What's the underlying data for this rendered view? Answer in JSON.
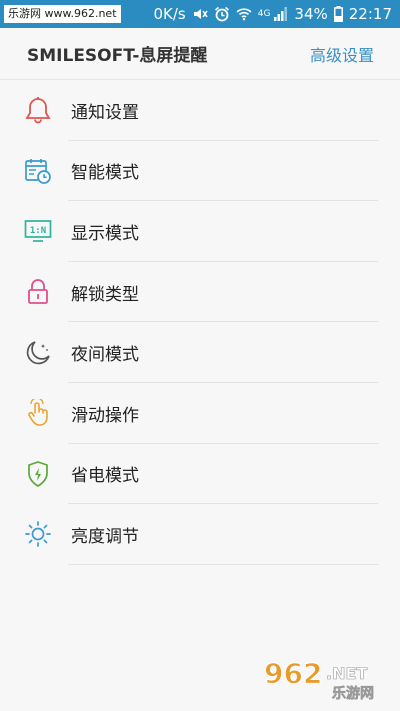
{
  "status_bar": {
    "watermark": "乐游网 www.962.net",
    "net_speed": "0K/s",
    "network_type": "4G",
    "battery": "34%",
    "time": "22:17"
  },
  "header": {
    "title": "SMILESOFT-息屏提醒",
    "advanced_settings": "高级设置"
  },
  "menu": [
    {
      "label": "通知设置",
      "icon": "bell-icon",
      "color": "#e0564e"
    },
    {
      "label": "智能模式",
      "icon": "calendar-clock-icon",
      "color": "#3a9bd0"
    },
    {
      "label": "显示模式",
      "icon": "display-icon",
      "color": "#2fb39a"
    },
    {
      "label": "解锁类型",
      "icon": "lock-icon",
      "color": "#e0508a"
    },
    {
      "label": "夜间模式",
      "icon": "moon-icon",
      "color": "#555555"
    },
    {
      "label": "滑动操作",
      "icon": "swipe-hand-icon",
      "color": "#e8a533"
    },
    {
      "label": "省电模式",
      "icon": "battery-bolt-icon",
      "color": "#5aa83c"
    },
    {
      "label": "亮度调节",
      "icon": "sun-icon",
      "color": "#3a9bd0"
    }
  ],
  "display_mode_icon_text": "1:N",
  "watermark_logo": {
    "number": "962",
    "suffix": ".NET",
    "caption": "乐游网"
  }
}
